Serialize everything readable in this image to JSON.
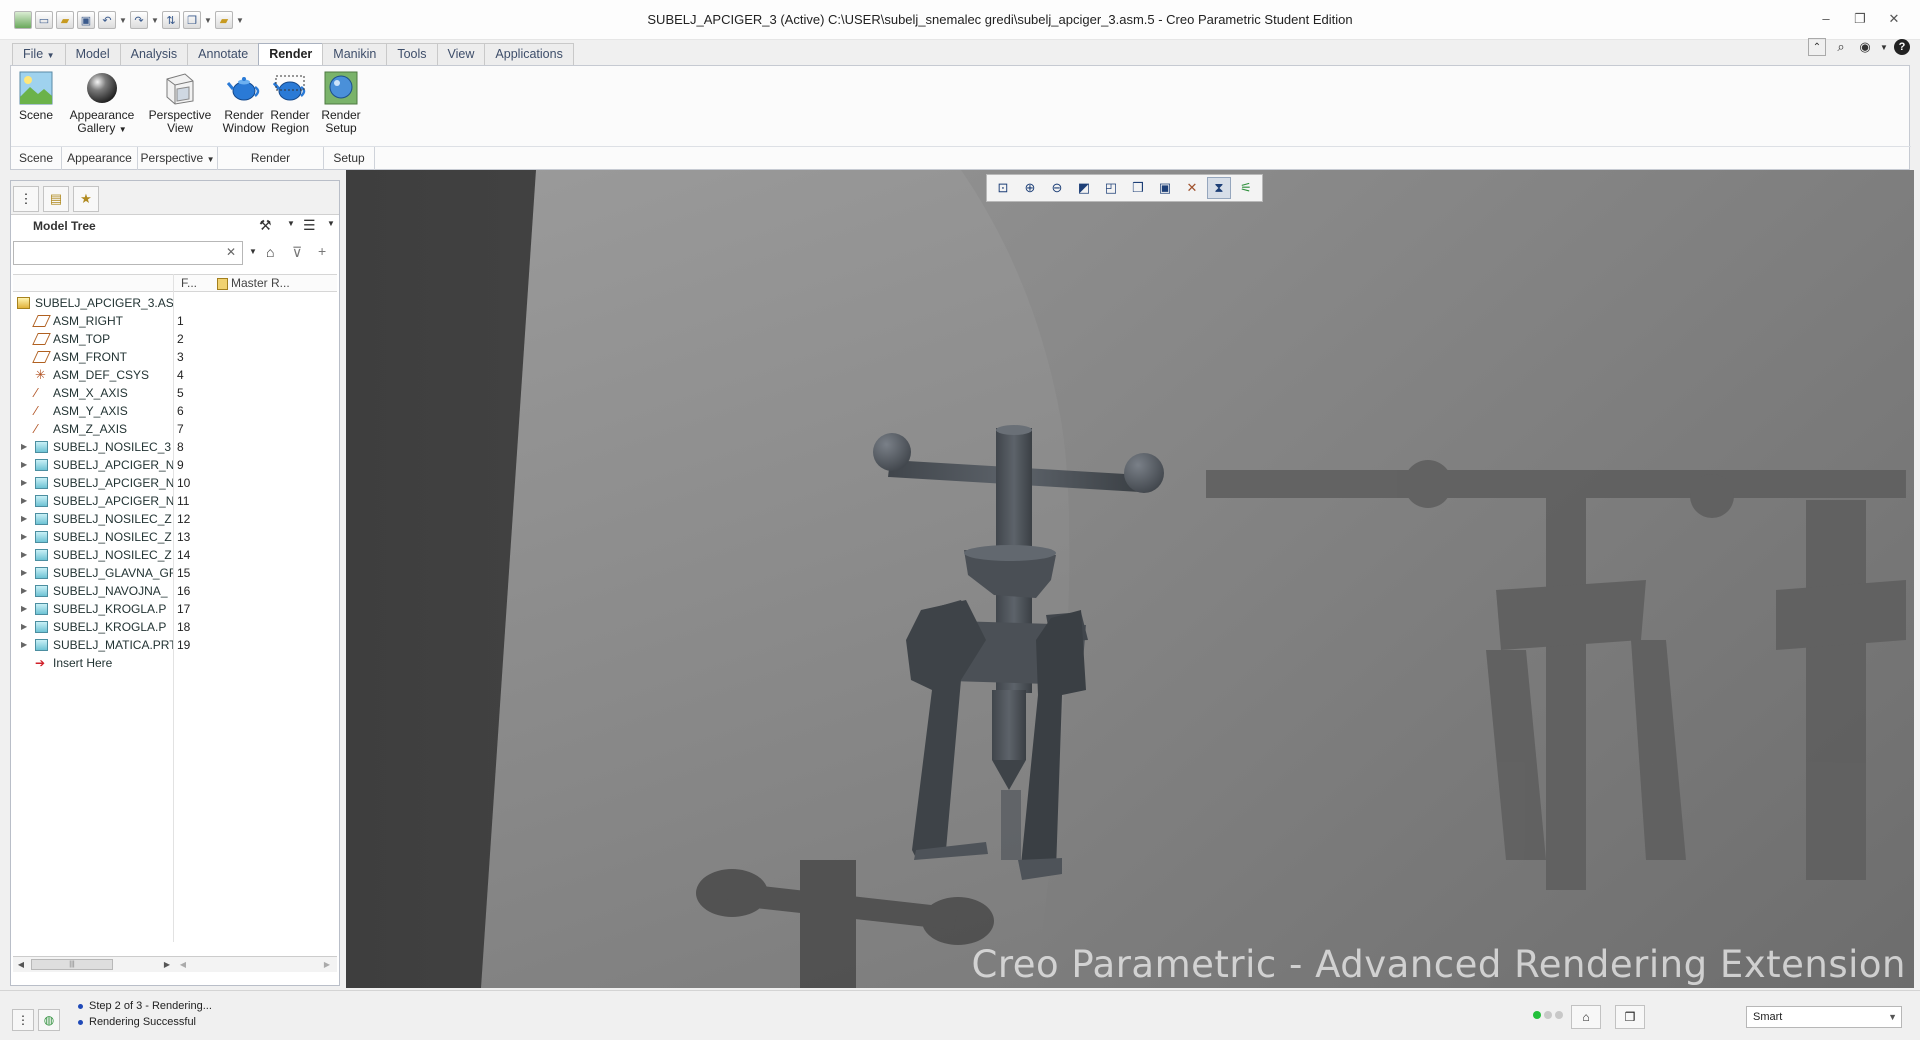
{
  "window": {
    "title": "SUBELJ_APCIGER_3 (Active) C:\\USER\\subelj_snemalec gredi\\subelj_apciger_3.asm.5 - Creo Parametric Student Edition"
  },
  "quick_access": [
    "new-icon",
    "open-icon",
    "save-icon",
    "undo-icon",
    "redo-icon",
    "regenerate-icon",
    "windows-icon",
    "close-icon",
    "customize-icon"
  ],
  "ribbon": {
    "tabs": [
      "File",
      "Model",
      "Analysis",
      "Annotate",
      "Render",
      "Manikin",
      "Tools",
      "View",
      "Applications"
    ],
    "active_tab": "Render",
    "buttons": {
      "scene": "Scene",
      "appearance_gallery_1": "Appearance",
      "appearance_gallery_2": "Gallery",
      "perspective_view_1": "Perspective",
      "perspective_view_2": "View",
      "render_window_1": "Render",
      "render_window_2": "Window",
      "render_region_1": "Render",
      "render_region_2": "Region",
      "render_setup_1": "Render",
      "render_setup_2": "Setup"
    },
    "groups": {
      "scene": "Scene",
      "appearance": "Appearance",
      "perspective": "Perspective",
      "render": "Render",
      "setup": "Setup"
    }
  },
  "model_tree": {
    "title": "Model Tree",
    "search_value": "",
    "columns": {
      "feat": "F...",
      "master": "Master R..."
    },
    "rows": [
      {
        "label": "SUBELJ_APCIGER_3.AS",
        "num": "",
        "icon": "asm",
        "expand": false,
        "level": 0
      },
      {
        "label": "ASM_RIGHT",
        "num": "1",
        "icon": "datum",
        "expand": false,
        "level": 1
      },
      {
        "label": "ASM_TOP",
        "num": "2",
        "icon": "datum",
        "expand": false,
        "level": 1
      },
      {
        "label": "ASM_FRONT",
        "num": "3",
        "icon": "datum",
        "expand": false,
        "level": 1
      },
      {
        "label": "ASM_DEF_CSYS",
        "num": "4",
        "icon": "csys",
        "expand": false,
        "level": 1
      },
      {
        "label": "ASM_X_AXIS",
        "num": "5",
        "icon": "axis",
        "expand": false,
        "level": 1
      },
      {
        "label": "ASM_Y_AXIS",
        "num": "6",
        "icon": "axis",
        "expand": false,
        "level": 1
      },
      {
        "label": "ASM_Z_AXIS",
        "num": "7",
        "icon": "axis",
        "expand": false,
        "level": 1
      },
      {
        "label": "SUBELJ_NOSILEC_3",
        "num": "8",
        "icon": "part",
        "expand": true,
        "level": 1
      },
      {
        "label": "SUBELJ_APCIGER_N",
        "num": "9",
        "icon": "part",
        "expand": true,
        "level": 1
      },
      {
        "label": "SUBELJ_APCIGER_N",
        "num": "10",
        "icon": "part",
        "expand": true,
        "level": 1
      },
      {
        "label": "SUBELJ_APCIGER_N",
        "num": "11",
        "icon": "part",
        "expand": true,
        "level": 1
      },
      {
        "label": "SUBELJ_NOSILEC_Z",
        "num": "12",
        "icon": "part",
        "expand": true,
        "level": 1
      },
      {
        "label": "SUBELJ_NOSILEC_Z",
        "num": "13",
        "icon": "part",
        "expand": true,
        "level": 1
      },
      {
        "label": "SUBELJ_NOSILEC_Z",
        "num": "14",
        "icon": "part",
        "expand": true,
        "level": 1
      },
      {
        "label": "SUBELJ_GLAVNA_GF",
        "num": "15",
        "icon": "part",
        "expand": true,
        "level": 1
      },
      {
        "label": "SUBELJ_NAVOJNA_",
        "num": "16",
        "icon": "part",
        "expand": true,
        "level": 1
      },
      {
        "label": "SUBELJ_KROGLA.P",
        "num": "17",
        "icon": "part",
        "expand": true,
        "level": 1
      },
      {
        "label": "SUBELJ_KROGLA.P",
        "num": "18",
        "icon": "part",
        "expand": true,
        "level": 1
      },
      {
        "label": "SUBELJ_MATICA.PRT",
        "num": "19",
        "icon": "part",
        "expand": true,
        "level": 1
      },
      {
        "label": "Insert Here",
        "num": "",
        "icon": "insert",
        "expand": false,
        "level": 1
      }
    ]
  },
  "viewport": {
    "watermark": "Creo Parametric - Advanced Rendering Extension",
    "toolbar_icons": [
      "refit-icon",
      "zoom-in-icon",
      "zoom-out-icon",
      "repaint-icon",
      "saved-orientations-icon",
      "view-manager-icon",
      "display-style-icon",
      "datum-display-icon",
      "spin-center-icon",
      "annotation-display-icon",
      "hierarchy-icon"
    ]
  },
  "status": {
    "messages": [
      "Step 2 of 3 - Rendering...",
      "Rendering Successful"
    ],
    "filter_value": "Smart",
    "light_colors": [
      "#22c03a",
      "#c8c8c8",
      "#c8c8c8"
    ]
  }
}
